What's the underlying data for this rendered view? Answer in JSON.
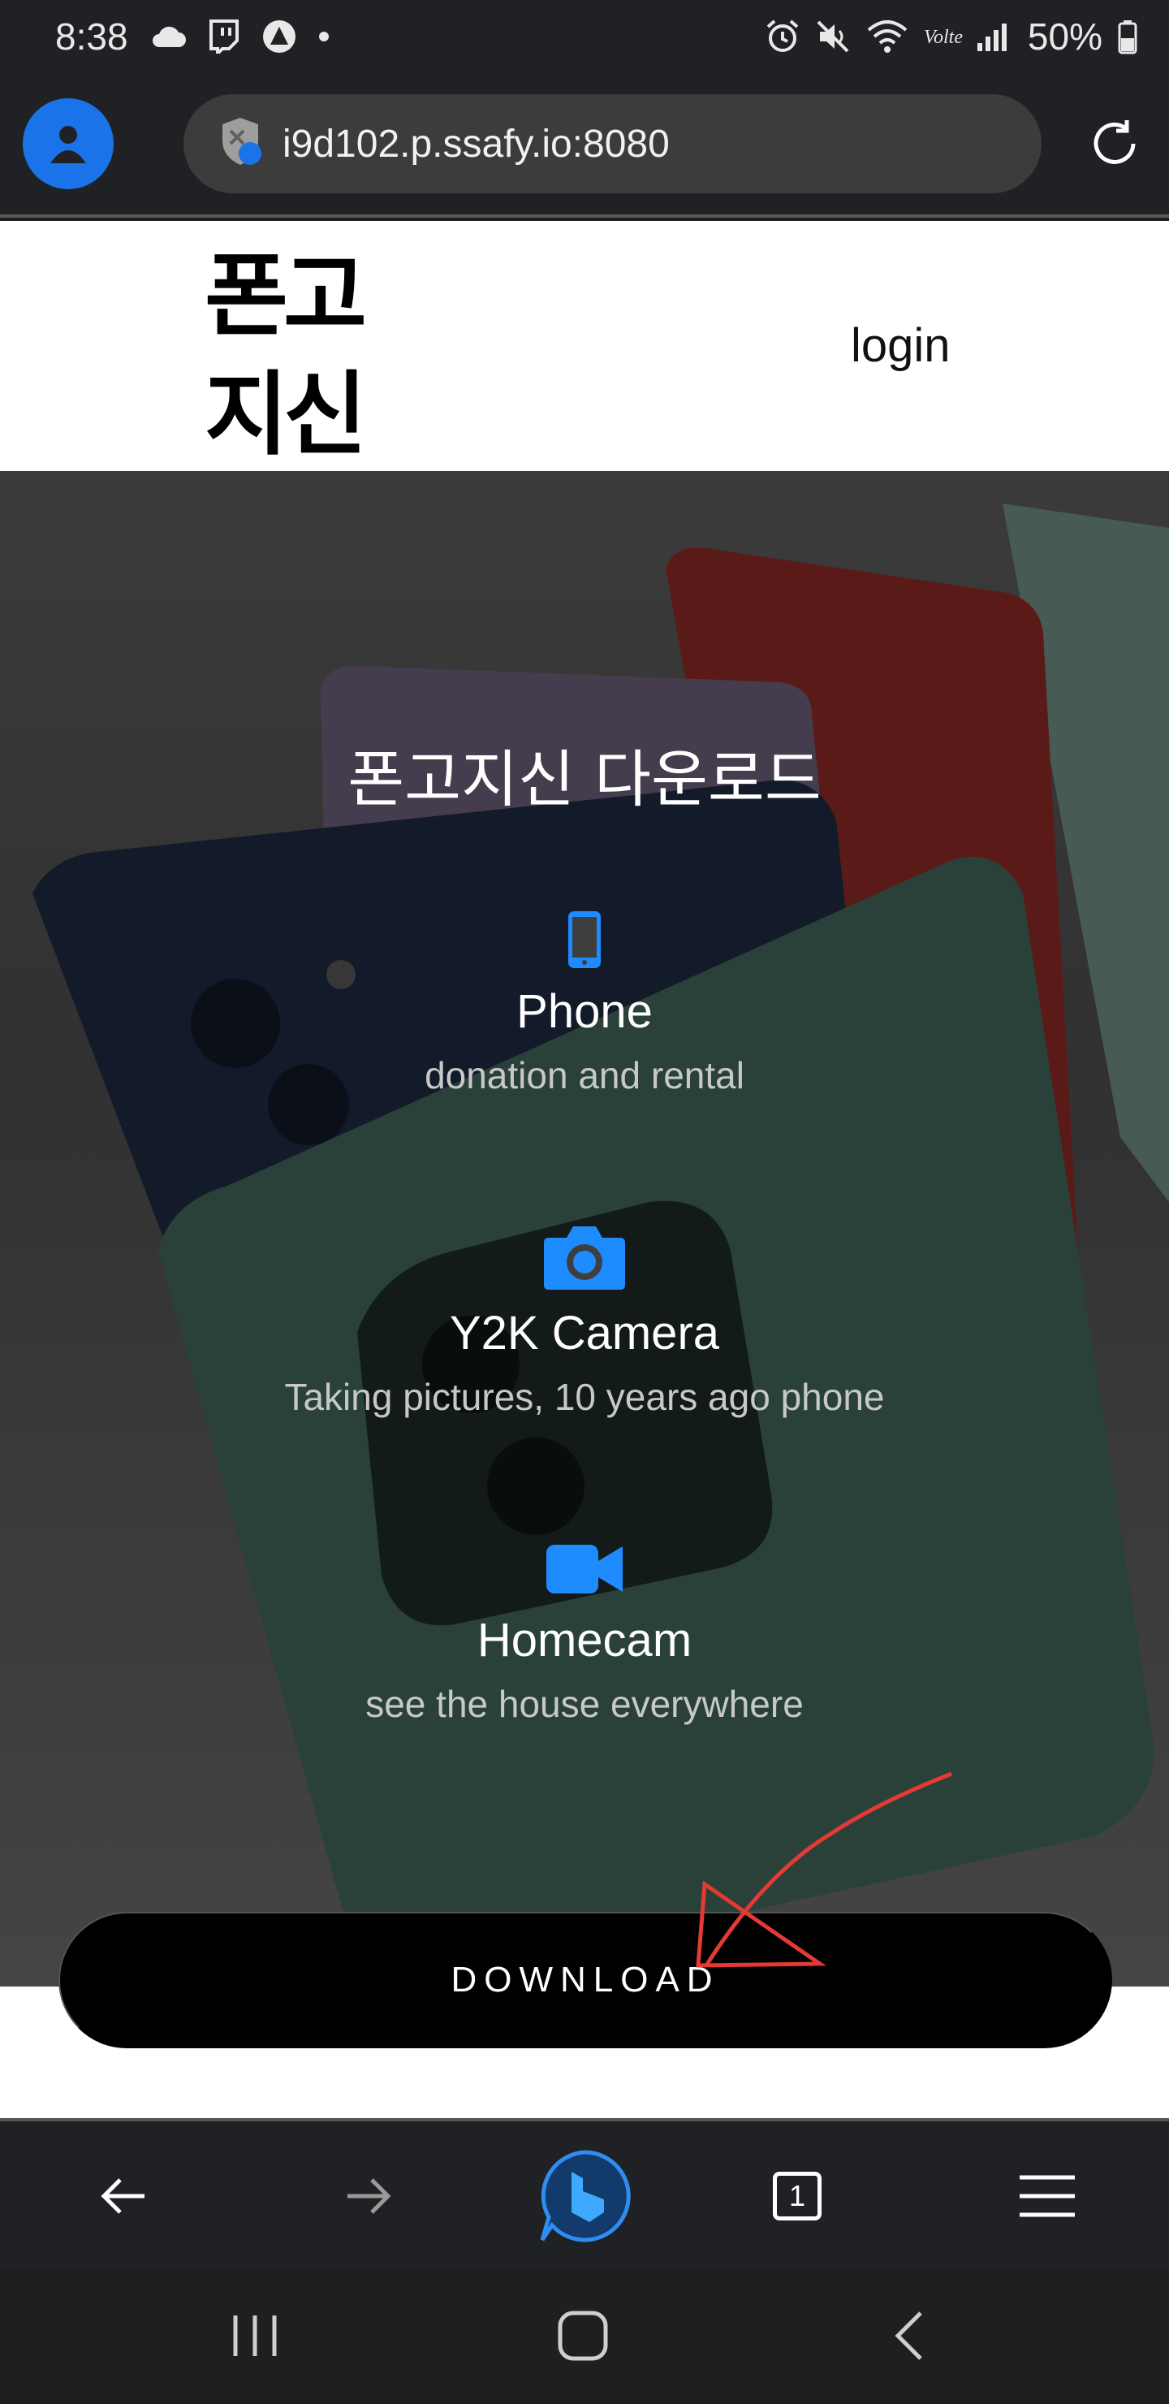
{
  "status_bar": {
    "time": "8:38",
    "battery": "50%",
    "network_label": "Volte"
  },
  "browser": {
    "url": "i9d102.p.ssafy.io:8080",
    "tab_count": "1",
    "accent": "#1a73e8"
  },
  "header": {
    "logo_line1": "폰고",
    "logo_line2": "지신",
    "login": "login"
  },
  "hero": {
    "title": "폰고지신 다운로드",
    "features": [
      {
        "icon": "mobile-phone-icon",
        "title": "Phone",
        "subtitle": "donation and rental"
      },
      {
        "icon": "camera-icon",
        "title": "Y2K Camera",
        "subtitle": "Taking pictures, 10 years ago phone"
      },
      {
        "icon": "video-camera-icon",
        "title": "Homecam",
        "subtitle": "see the house everywhere"
      }
    ],
    "icon_color": "#1e8cff"
  },
  "download_button": "DOWNLOAD",
  "annotation_color": "#e53935"
}
